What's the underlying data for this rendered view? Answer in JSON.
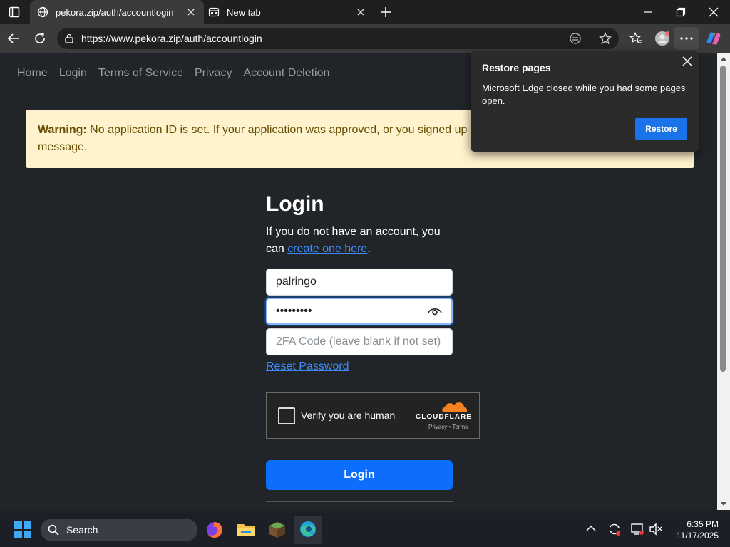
{
  "tabs": [
    {
      "title": "pekora.zip/auth/accountlogin",
      "active": true
    },
    {
      "title": "New tab",
      "active": false
    }
  ],
  "address": {
    "url": "https://www.pekora.zip/auth/accountlogin"
  },
  "nav": [
    "Home",
    "Login",
    "Terms of Service",
    "Privacy",
    "Account Deletion"
  ],
  "warning": {
    "label": "Warning:",
    "text": " No application ID is set. If your application was approved, or you signed up",
    "text2": "message."
  },
  "login": {
    "title": "Login",
    "desc_prefix": "If you do not have an account, you can ",
    "desc_link": "create one here",
    "desc_suffix": ".",
    "username": "palringo",
    "password_mask": "•••••••••",
    "twofa_placeholder": "2FA Code (leave blank if not set)",
    "reset_link": "Reset Password",
    "button": "Login"
  },
  "captcha": {
    "label": "Verify you are human",
    "brand": "CLOUDFLARE",
    "links": "Privacy  •  Terms"
  },
  "restore_popup": {
    "title": "Restore pages",
    "message": "Microsoft Edge closed while you had some pages open.",
    "button": "Restore"
  },
  "taskbar": {
    "search_label": "Search",
    "time": "6:35 PM",
    "date": "11/17/2025"
  },
  "colors": {
    "page_bg": "#212529",
    "accent": "#0d6efd",
    "warning_bg": "#fff3cd",
    "popup_button": "#1a73e8"
  }
}
